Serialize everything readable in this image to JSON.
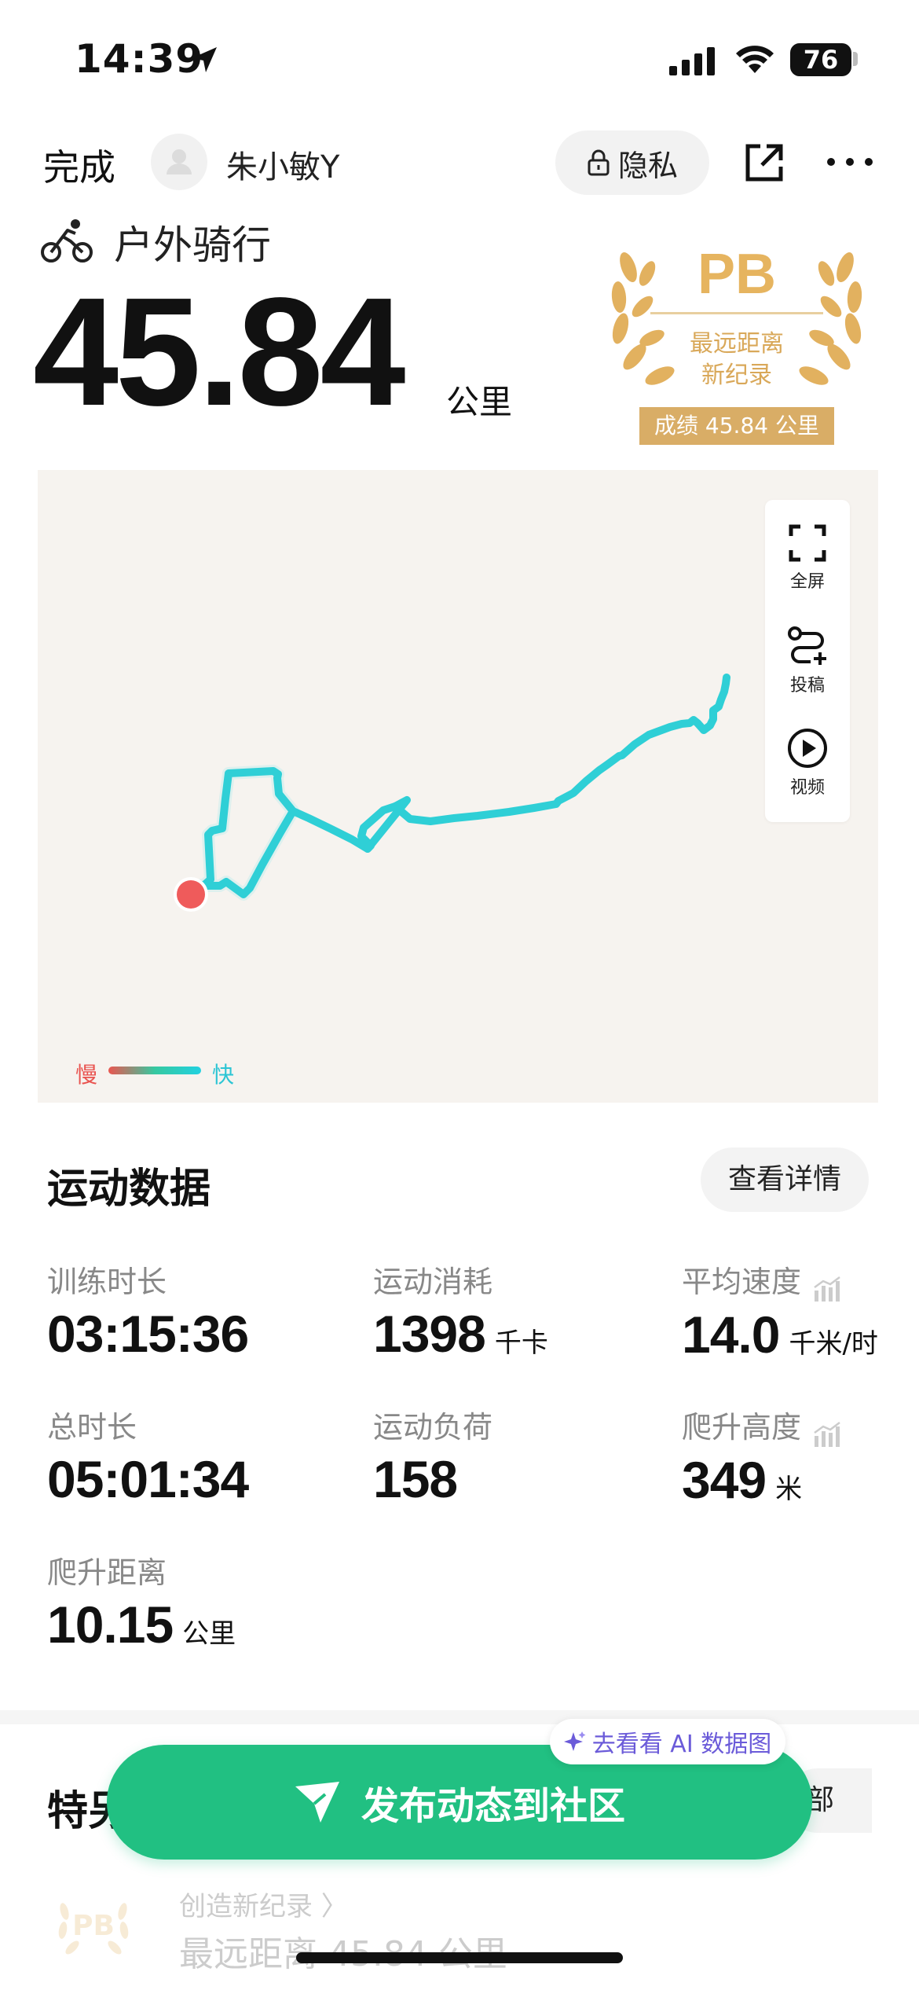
{
  "status_bar": {
    "time": "14:39",
    "battery": "76"
  },
  "header": {
    "done_label": "完成",
    "username": "朱小敏Y",
    "privacy_label": "隐私"
  },
  "activity": {
    "type": "户外骑行",
    "distance": "45.84",
    "distance_unit": "公里"
  },
  "pb_badge": {
    "title": "PB",
    "subtitle_line1": "最远距离",
    "subtitle_line2": "新纪录",
    "result": "成绩 45.84 公里"
  },
  "map": {
    "tools": [
      {
        "label": "全屏",
        "icon": "fullscreen-icon"
      },
      {
        "label": "投稿",
        "icon": "route-add-icon"
      },
      {
        "label": "视频",
        "icon": "play-icon"
      }
    ],
    "legend": {
      "slow": "慢",
      "fast": "快"
    },
    "colors": {
      "route": "#2fcfd6",
      "start": "#ef5b5b",
      "background": "#f6f3ef"
    }
  },
  "stats": {
    "title": "运动数据",
    "details_label": "查看详情",
    "items": [
      {
        "label": "训练时长",
        "value": "03:15:36",
        "unit": ""
      },
      {
        "label": "运动消耗",
        "value": "1398",
        "unit": "千卡"
      },
      {
        "label": "平均速度",
        "value": "14.0",
        "unit": "千米/时"
      },
      {
        "label": "总时长",
        "value": "05:01:34",
        "unit": ""
      },
      {
        "label": "运动负荷",
        "value": "158",
        "unit": ""
      },
      {
        "label": "爬升高度",
        "value": "349",
        "unit": "米"
      },
      {
        "label": "爬升距离",
        "value": "10.15",
        "unit": "公里"
      }
    ]
  },
  "background_section": {
    "title_visible": "特另",
    "all_label": "部",
    "record_line1": "创造新纪录 〉",
    "record_line2": "最远距离 45.84 公里",
    "badge_text": "PB"
  },
  "cta": {
    "ai_pill": "去看看 AI 数据图",
    "publish_label": "发布动态到社区",
    "color": "#21c082"
  }
}
